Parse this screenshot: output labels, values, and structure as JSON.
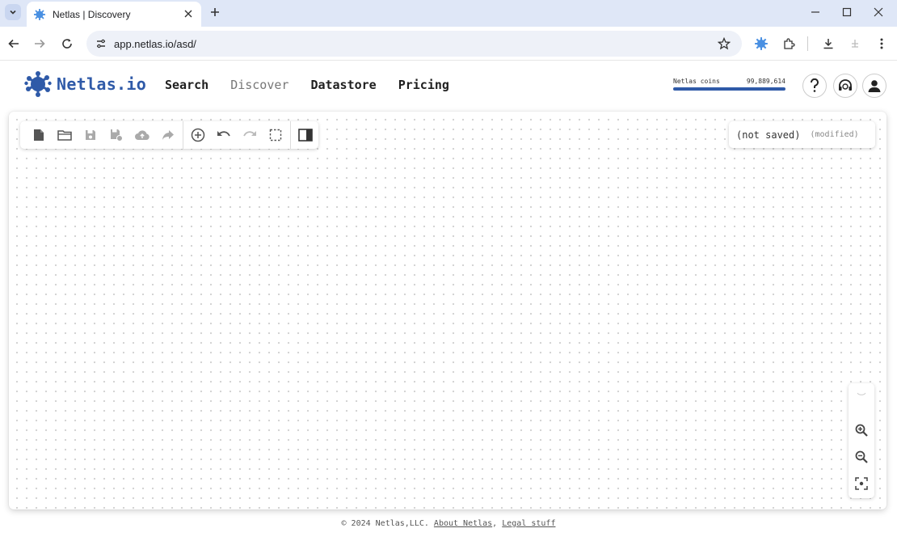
{
  "browser": {
    "tab_title": "Netlas | Discovery",
    "url": "app.netlas.io/asd/"
  },
  "header": {
    "logo_text": "Netlas.io",
    "nav": [
      "Search",
      "Discover",
      "Datastore",
      "Pricing"
    ],
    "coins_label": "Netlas coins",
    "coins_value": "99,889,614",
    "brand_color": "#2f5aa8"
  },
  "editor": {
    "toolbar_icons": [
      "new-file-icon",
      "open-folder-icon",
      "save-icon",
      "save-as-icon",
      "cloud-upload-icon",
      "share-icon",
      "add-node-icon",
      "undo-icon",
      "redo-icon",
      "select-area-icon",
      "panel-toggle-icon"
    ],
    "status_main": "(not saved)",
    "status_sub": "(modified)"
  },
  "zoom": [
    "zoom-in-icon",
    "zoom-out-icon",
    "fit-screen-icon"
  ],
  "footer": {
    "copyright": "© 2024 Netlas,LLC.",
    "about": "About Netlas",
    "separator": ",",
    "legal": "Legal stuff"
  }
}
